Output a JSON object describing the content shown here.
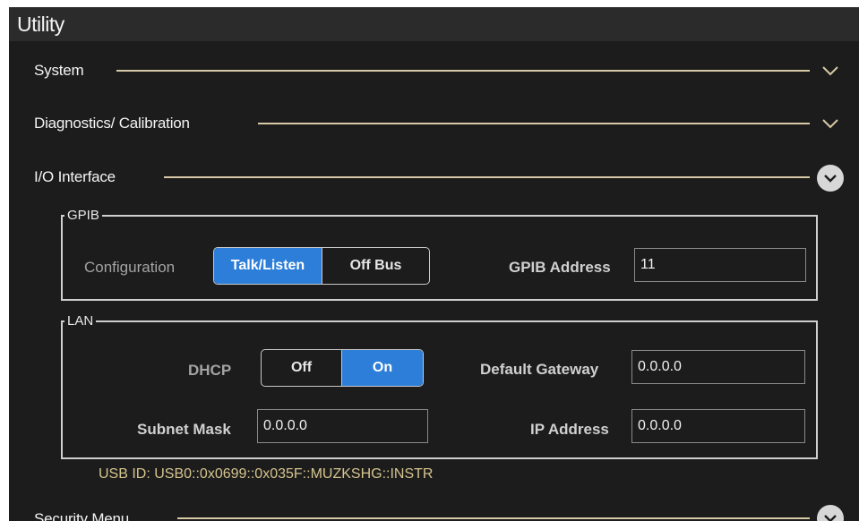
{
  "window": {
    "title": "Utility"
  },
  "sections": {
    "system": {
      "label": "System"
    },
    "diagnostics": {
      "label": "Diagnostics/ Calibration"
    },
    "io": {
      "label": "I/O Interface"
    },
    "security": {
      "label": "Security Menu"
    }
  },
  "gpib": {
    "legend": "GPIB",
    "configuration_label": "Configuration",
    "options": [
      "Talk/Listen",
      "Off Bus"
    ],
    "selected": "Talk/Listen",
    "address_label": "GPIB Address",
    "address_value": "11"
  },
  "lan": {
    "legend": "LAN",
    "dhcp_label": "DHCP",
    "dhcp_options": [
      "Off",
      "On"
    ],
    "dhcp_selected": "On",
    "gateway_label": "Default Gateway",
    "gateway_value": "0.0.0.0",
    "subnet_label": "Subnet Mask",
    "subnet_value": "0.0.0.0",
    "ip_label": "IP Address",
    "ip_value": "0.0.0.0"
  },
  "usb_id": "USB ID: USB0::0x0699::0x035F::MUZKSHG::INSTR",
  "colors": {
    "accent": "#2c7ed9",
    "divider": "#d8c9a6",
    "usb_text": "#d6c48e",
    "background": "#1c1c1c"
  },
  "icons": {
    "collapsed": "chevron-down-icon",
    "expanded": "chevron-down-circle-icon"
  }
}
